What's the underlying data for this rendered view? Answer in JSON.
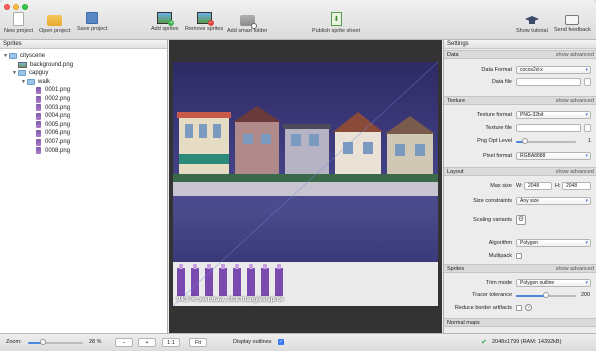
{
  "toolbar": {
    "items": [
      {
        "label": "New project",
        "icon": "new-document-icon"
      },
      {
        "label": "Open project",
        "icon": "folder-icon"
      },
      {
        "label": "Save project",
        "icon": "floppy-disk-icon"
      },
      {
        "label": "Add sprites",
        "icon": "add-sprite-icon"
      },
      {
        "label": "Remove sprites",
        "icon": "remove-sprite-icon"
      },
      {
        "label": "Add smart folder",
        "icon": "smart-folder-icon"
      },
      {
        "label": "Publish sprite sheet",
        "icon": "publish-icon"
      },
      {
        "label": "Show tutorial",
        "icon": "graduation-cap-icon"
      },
      {
        "label": "Send feedback",
        "icon": "feedback-icon"
      }
    ]
  },
  "sprites_panel": {
    "title": "Sprites",
    "tree": [
      {
        "label": "cityscene",
        "kind": "folder",
        "depth": 0
      },
      {
        "label": "background.png",
        "kind": "image",
        "depth": 1
      },
      {
        "label": "capguy",
        "kind": "folder",
        "depth": 1
      },
      {
        "label": "walk",
        "kind": "folder",
        "depth": 2
      },
      {
        "label": "0001.png",
        "kind": "png",
        "depth": 3
      },
      {
        "label": "0002.png",
        "kind": "png",
        "depth": 3
      },
      {
        "label": "0003.png",
        "kind": "png",
        "depth": 3
      },
      {
        "label": "0004.png",
        "kind": "png",
        "depth": 3
      },
      {
        "label": "0005.png",
        "kind": "png",
        "depth": 3
      },
      {
        "label": "0006.png",
        "kind": "png",
        "depth": 3
      },
      {
        "label": "0007.png",
        "kind": "png",
        "depth": 3
      },
      {
        "label": "0008.png",
        "kind": "png",
        "depth": 3
      }
    ]
  },
  "canvas": {
    "overlay_text": "94.9 % overdraw, 10.8 triangles/sprite"
  },
  "settings": {
    "title": "Settings",
    "sections": {
      "data": {
        "label": "Data",
        "adv": "show advanced"
      },
      "texture": {
        "label": "Texture",
        "adv": "show advanced"
      },
      "layout": {
        "label": "Layout",
        "adv": "show advanced"
      },
      "sprites": {
        "label": "Sprites",
        "adv": "show advanced"
      },
      "normal": {
        "label": "Normal maps"
      }
    },
    "data_format": {
      "label": "Data Format",
      "value": "cocos2d-x"
    },
    "data_file": {
      "label": "Data file",
      "value": ""
    },
    "texture_format": {
      "label": "Texture format",
      "value": "PNG-32bit"
    },
    "texture_file": {
      "label": "Texture file",
      "value": ""
    },
    "png_opt": {
      "label": "Png Opt Level",
      "value": "1",
      "level": 0.15
    },
    "pixel_format": {
      "label": "Pixel format",
      "value": "RGBA8888"
    },
    "max_size": {
      "label": "Max size",
      "w_label": "W:",
      "w": "2048",
      "h_label": "H:",
      "h": "2048"
    },
    "size_constraints": {
      "label": "Size constraints",
      "value": "Any size"
    },
    "scaling": {
      "label": "Scaling variants"
    },
    "algorithm": {
      "label": "Algorithm",
      "value": "Polygon"
    },
    "multipack": {
      "label": "Multipack"
    },
    "trim_mode": {
      "label": "Trim mode",
      "value": "Polygon outline"
    },
    "tracer": {
      "label": "Tracer tolerance",
      "value": "200",
      "level": 0.5
    },
    "reduce": {
      "label": "Reduce border artifacts"
    }
  },
  "status": {
    "zoom_label": "Zoom:",
    "zoom_value": "28 %",
    "zoom_level": 0.28,
    "minus": "−",
    "plus": "+",
    "one_to_one": "1:1",
    "fit": "Fit",
    "display_outlines": "Display outlines",
    "size_info": "2048x1799 (RAM: 14392kB)"
  },
  "colors": {
    "accent": "#3478f6",
    "sky": "#3d3a7c",
    "ok": "#2ea44f"
  }
}
